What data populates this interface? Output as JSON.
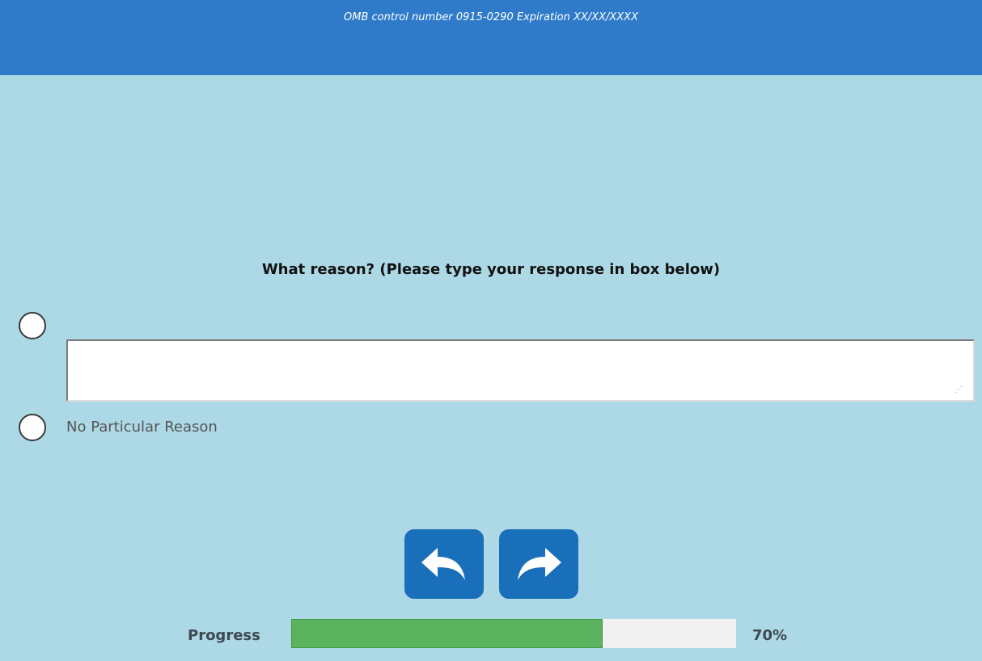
{
  "header": {
    "omb_text": "OMB control number 0915-0290 Expiration XX/XX/XXXX",
    "background_color": "#2f7bca"
  },
  "question": {
    "text": "What reason? (Please type your response in box below)"
  },
  "options": [
    {
      "type": "other-text",
      "selected": false,
      "input_value": "",
      "input_placeholder": ""
    },
    {
      "type": "choice",
      "label": "No Particular Reason",
      "selected": false
    }
  ],
  "navigation": {
    "back_icon": "arrow-back-curved-icon",
    "next_icon": "arrow-forward-curved-icon",
    "button_color": "#1a6fba"
  },
  "progress": {
    "label": "Progress",
    "value": 0.7,
    "percent_text": "70%",
    "fill_color": "#5cb35f"
  },
  "theme": {
    "page_background": "#add8e6"
  }
}
